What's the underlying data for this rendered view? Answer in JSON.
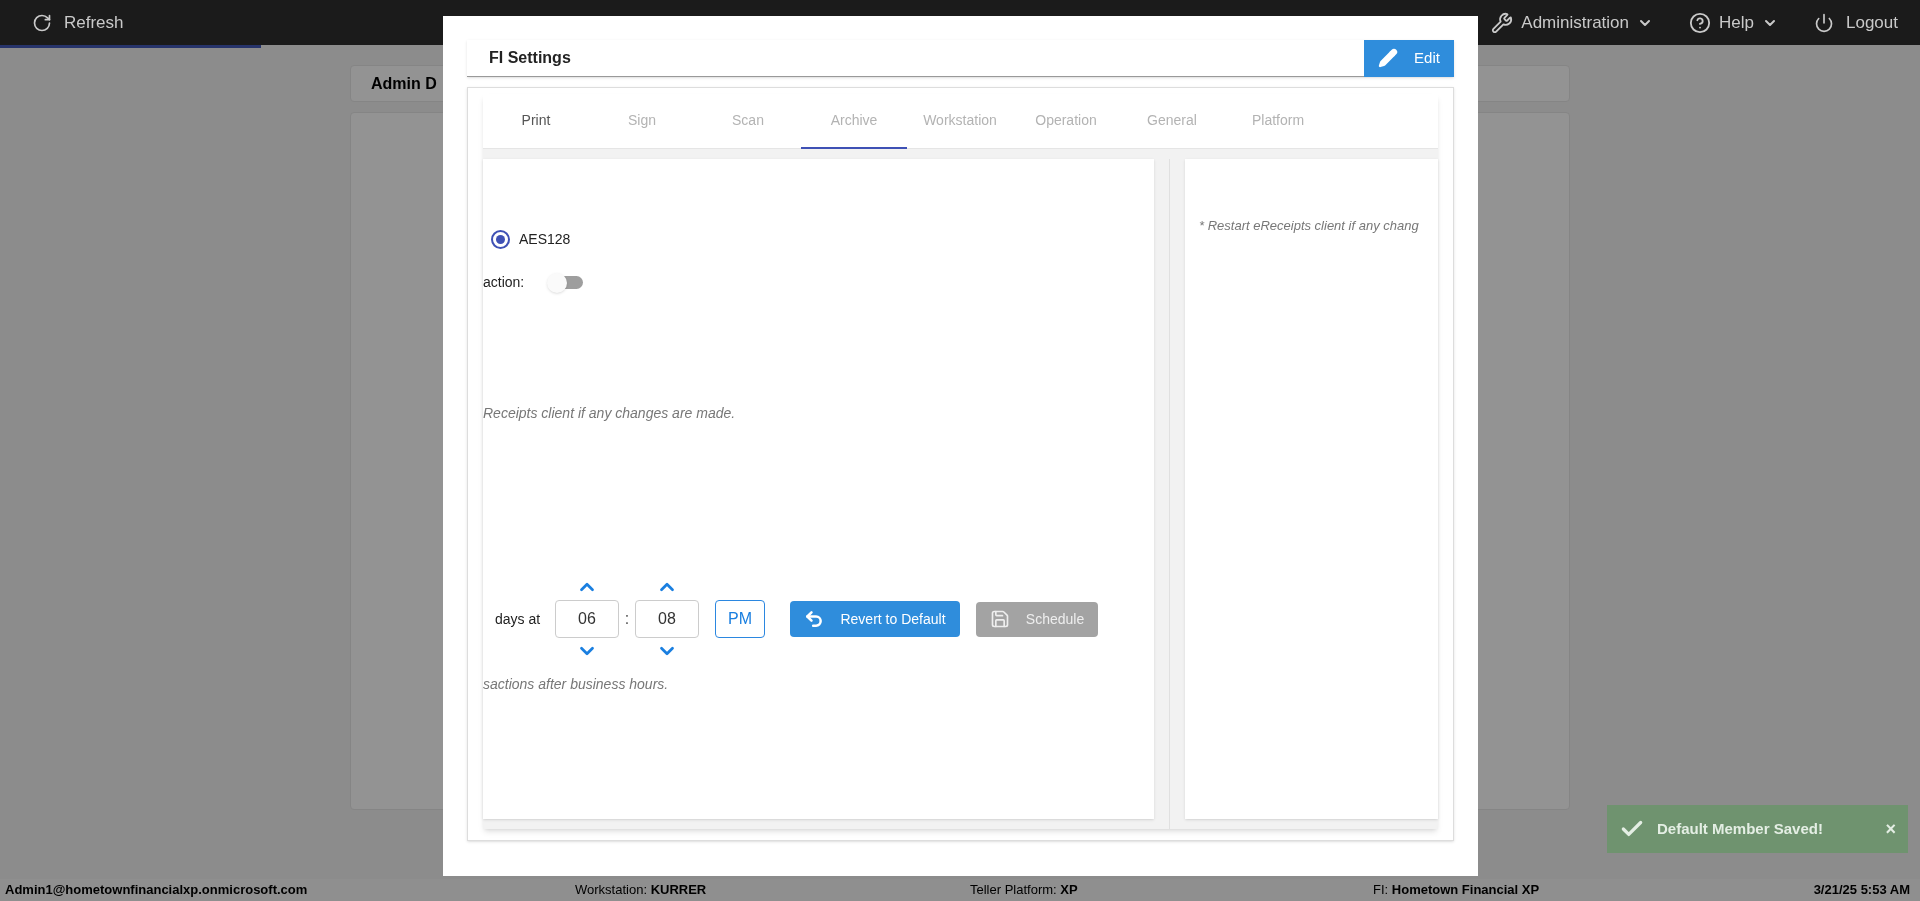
{
  "top_bar": {
    "progress": {
      "level": 0.136
    },
    "refresh_button": {
      "label": "Refresh"
    },
    "menus": [
      {
        "label": "Administration"
      },
      {
        "label": "Help"
      }
    ],
    "logout_button": {
      "label": "Logout"
    }
  },
  "background_panel": {
    "title": "Admin D"
  },
  "modal": {
    "title": "FI Settings",
    "edit_button": {
      "label": "Edit"
    },
    "tabs": [
      {
        "label": "Print",
        "selected": false,
        "disabled": false
      },
      {
        "label": "Sign",
        "selected": false,
        "disabled": true
      },
      {
        "label": "Scan",
        "selected": false,
        "disabled": true
      },
      {
        "label": "Archive",
        "selected": true,
        "disabled": true
      },
      {
        "label": "Workstation",
        "selected": false,
        "disabled": true
      },
      {
        "label": "Operation",
        "selected": false,
        "disabled": true
      },
      {
        "label": "General",
        "selected": false,
        "disabled": true
      },
      {
        "label": "Platform",
        "selected": false,
        "disabled": true
      }
    ],
    "left_panel": {
      "encryption_option": {
        "label": "AES128",
        "selected": true
      },
      "toggle": {
        "label": "action:",
        "on": false
      },
      "note_1": "Receipts client if any changes are made.",
      "schedule": {
        "prefix": "days at",
        "hour": "06",
        "separator": ":",
        "minute": "08",
        "meridiem": "PM",
        "revert_button": {
          "label": "Revert to Default"
        },
        "schedule_button": {
          "label": "Schedule",
          "disabled": true
        }
      },
      "note_2": "sactions after business hours."
    },
    "right_panel": {
      "note": "* Restart eReceipts client if any chang"
    }
  },
  "status_bar": {
    "user": "Admin1@hometownfinancialxp.onmicrosoft.com",
    "fields": [
      {
        "label": "Workstation:",
        "value": "KURRER"
      },
      {
        "label": "Teller Platform:",
        "value": "XP"
      },
      {
        "label": "FI:",
        "value": "Hometown Financial XP"
      }
    ],
    "datetime": "3/21/25 5:53 AM"
  },
  "toast": {
    "message": "Default Member Saved!",
    "close": "×"
  }
}
